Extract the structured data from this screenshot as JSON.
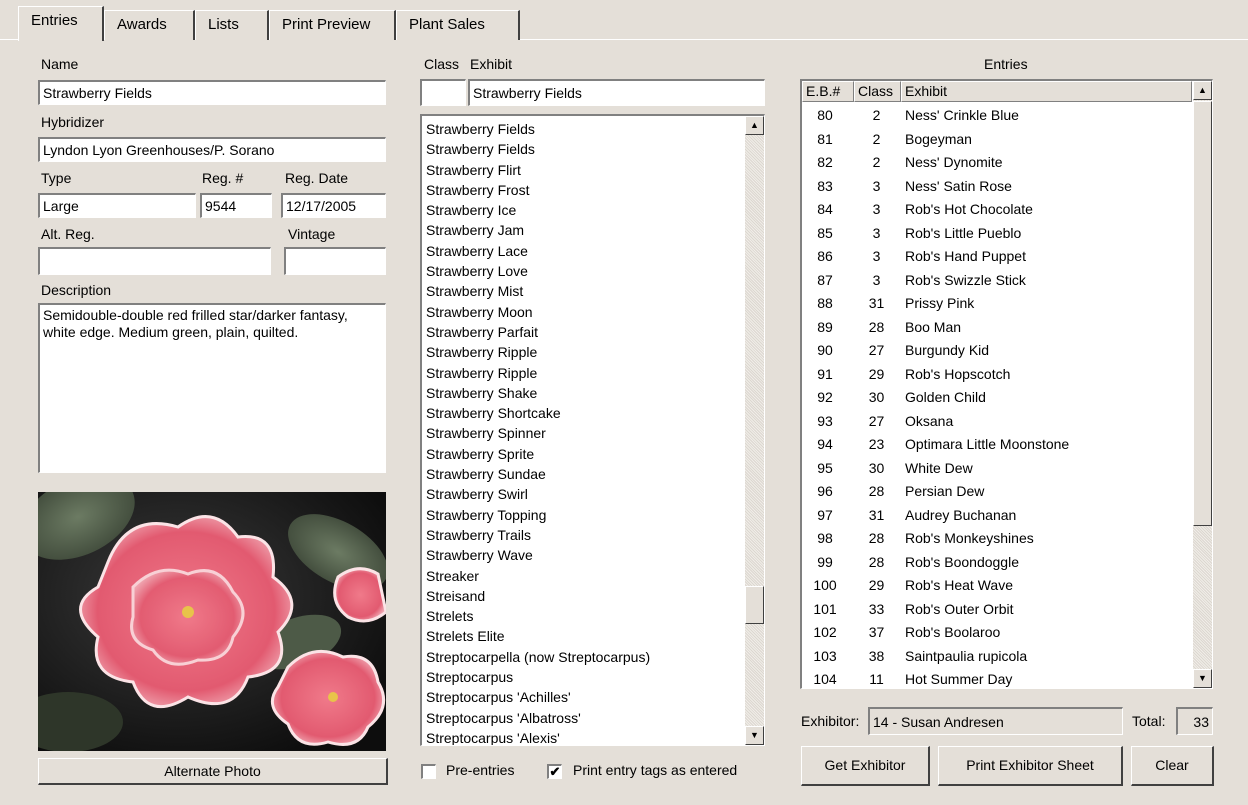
{
  "tabs": [
    "Entries",
    "Awards",
    "Lists",
    "Print Preview",
    "Plant Sales"
  ],
  "form": {
    "name_label": "Name",
    "name_value": "Strawberry Fields",
    "hybridizer_label": "Hybridizer",
    "hybridizer_value": "Lyndon Lyon Greenhouses/P. Sorano",
    "type_label": "Type",
    "type_value": "Large",
    "regnum_label": "Reg. #",
    "regnum_value": "9544",
    "regdate_label": "Reg. Date",
    "regdate_value": "12/17/2005",
    "altreg_label": "Alt. Reg.",
    "altreg_value": "",
    "vintage_label": "Vintage",
    "vintage_value": "",
    "description_label": "Description",
    "description_value": "Semidouble-double red frilled star/darker fantasy, white edge. Medium green, plain, quilted.",
    "alt_photo_button": "Alternate Photo"
  },
  "exhibit": {
    "class_label": "Class",
    "exhibit_label": "Exhibit",
    "class_value": "",
    "exhibit_value": "Strawberry Fields",
    "list": [
      "Strawberry Fields",
      "Strawberry Fields",
      "Strawberry Flirt",
      "Strawberry Frost",
      "Strawberry Ice",
      "Strawberry Jam",
      "Strawberry Lace",
      "Strawberry Love",
      "Strawberry Mist",
      "Strawberry Moon",
      "Strawberry Parfait",
      "Strawberry Ripple",
      "Strawberry Ripple",
      "Strawberry Shake",
      "Strawberry Shortcake",
      "Strawberry Spinner",
      "Strawberry Sprite",
      "Strawberry Sundae",
      "Strawberry Swirl",
      "Strawberry Topping",
      "Strawberry Trails",
      "Strawberry Wave",
      "Streaker",
      "Streisand",
      "Strelets",
      "Strelets Elite",
      "Streptocarpella (now Streptocarpus)",
      "Streptocarpus",
      "Streptocarpus 'Achilles'",
      "Streptocarpus 'Albatross'",
      "Streptocarpus 'Alexis'"
    ],
    "preentries_label": "Pre-entries",
    "preentries_checked": false,
    "printtags_label": "Print entry tags as entered",
    "printtags_checked": true
  },
  "entries": {
    "title": "Entries",
    "columns": [
      "E.B.#",
      "Class",
      "Exhibit"
    ],
    "rows": [
      [
        "80",
        "2",
        "Ness' Crinkle Blue"
      ],
      [
        "81",
        "2",
        "Bogeyman"
      ],
      [
        "82",
        "2",
        "Ness' Dynomite"
      ],
      [
        "83",
        "3",
        "Ness' Satin Rose"
      ],
      [
        "84",
        "3",
        "Rob's Hot Chocolate"
      ],
      [
        "85",
        "3",
        "Rob's Little Pueblo"
      ],
      [
        "86",
        "3",
        "Rob's Hand Puppet"
      ],
      [
        "87",
        "3",
        "Rob's Swizzle Stick"
      ],
      [
        "88",
        "31",
        "Prissy Pink"
      ],
      [
        "89",
        "28",
        "Boo Man"
      ],
      [
        "90",
        "27",
        "Burgundy Kid"
      ],
      [
        "91",
        "29",
        "Rob's Hopscotch"
      ],
      [
        "92",
        "30",
        "Golden Child"
      ],
      [
        "93",
        "27",
        "Oksana"
      ],
      [
        "94",
        "23",
        "Optimara Little Moonstone"
      ],
      [
        "95",
        "30",
        "White Dew"
      ],
      [
        "96",
        "28",
        "Persian Dew"
      ],
      [
        "97",
        "31",
        "Audrey Buchanan"
      ],
      [
        "98",
        "28",
        "Rob's Monkeyshines"
      ],
      [
        "99",
        "28",
        "Rob's Boondoggle"
      ],
      [
        "100",
        "29",
        "Rob's Heat Wave"
      ],
      [
        "101",
        "33",
        "Rob's Outer Orbit"
      ],
      [
        "102",
        "37",
        "Rob's Boolaroo"
      ],
      [
        "103",
        "38",
        "Saintpaulia rupicola"
      ],
      [
        "104",
        "11",
        "Hot Summer Day"
      ]
    ],
    "exhibitor_label": "Exhibitor:",
    "exhibitor_value": "14 - Susan Andresen",
    "total_label": "Total:",
    "total_value": "33",
    "get_exhibitor_button": "Get Exhibitor",
    "print_sheet_button": "Print Exhibitor Sheet",
    "clear_button": "Clear"
  },
  "icons": {
    "scroll_up": "up-arrow-icon",
    "scroll_down": "down-arrow-icon",
    "check": "checkmark-icon"
  }
}
